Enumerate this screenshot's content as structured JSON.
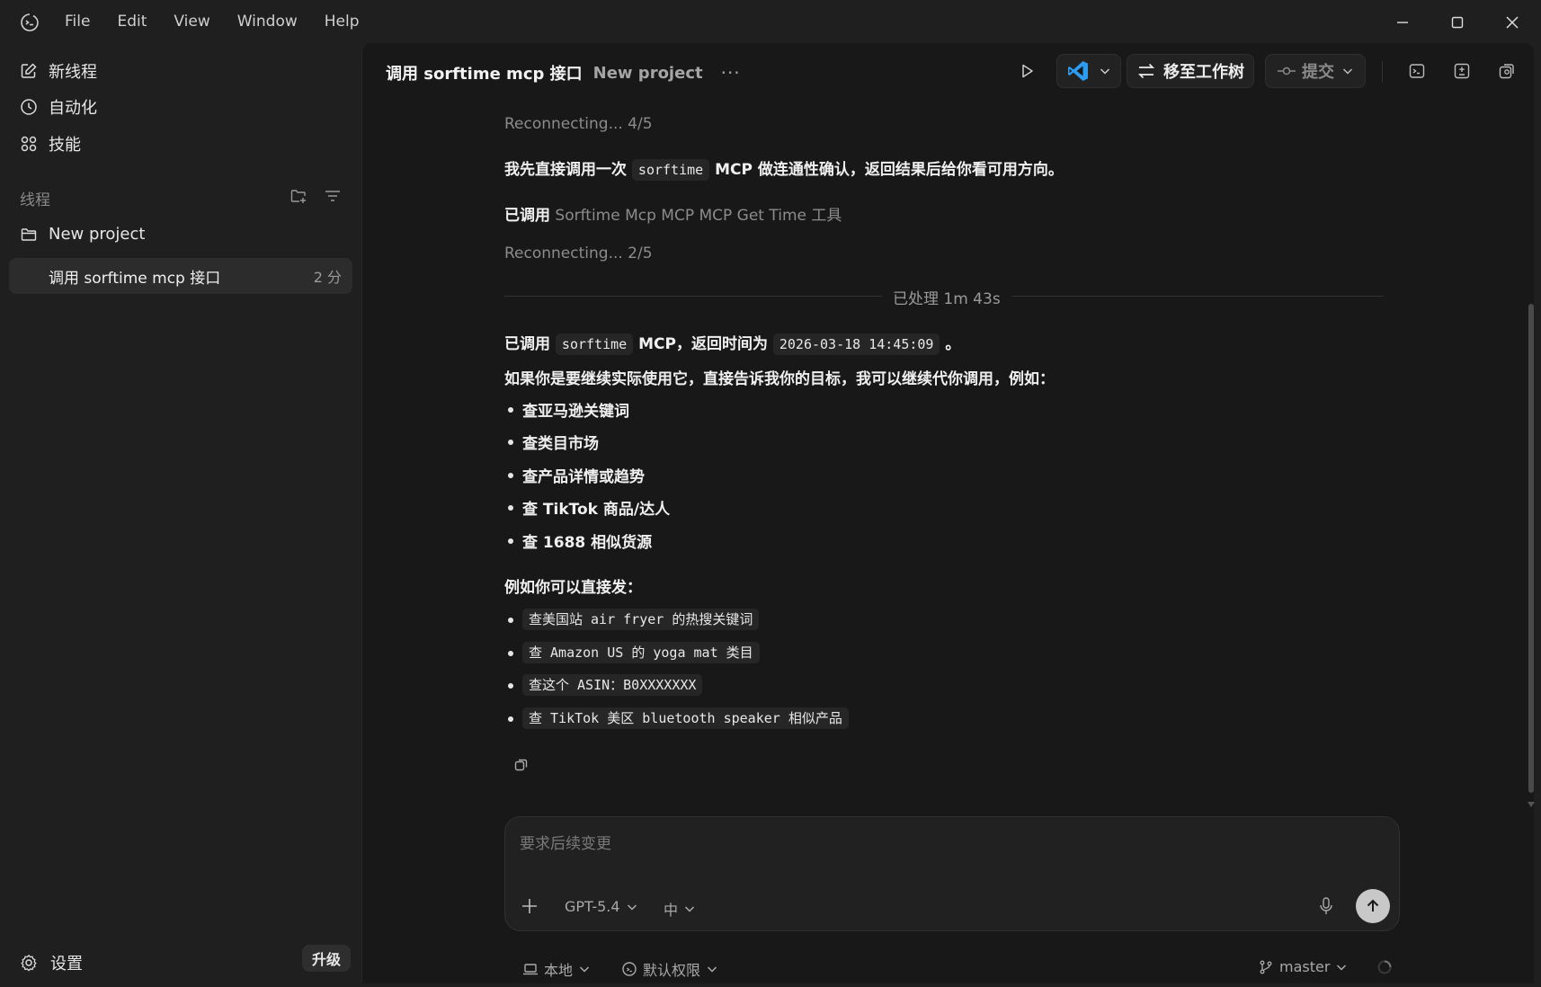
{
  "menu": [
    "File",
    "Edit",
    "Window",
    "Help"
  ],
  "menu_view": "View",
  "sidebar": {
    "new_thread": "新线程",
    "automation": "自动化",
    "skills": "技能",
    "section_label": "线程",
    "project": "New project",
    "thread": {
      "title": "调用 sorftime mcp 接口",
      "time": "2 分"
    },
    "settings": "设置",
    "upgrade": "升级"
  },
  "header": {
    "title": "调用 sorftime mcp 接口",
    "project": "New project",
    "more": "···",
    "move_to_worktree": "移至工作树",
    "commit": "提交"
  },
  "messages": {
    "reconnect1": "Reconnecting... 4/5",
    "intro_a": "我先直接调用一次",
    "intro_code": "sorftime",
    "intro_b": "MCP 做连通性确认，返回结果后给你看可用方向。",
    "tool_prefix": "已调用",
    "tool_name": "Sorftime Mcp MCP MCP Get Time 工具",
    "reconnect2": "Reconnecting... 2/5",
    "processed": "已处理 1m 43s",
    "result_a": "已调用",
    "result_code1": "sorftime",
    "result_b": "MCP，返回时间为",
    "result_code2": "2026-03-18 14:45:09",
    "result_c": "。",
    "followup": "如果你是要继续实际使用它，直接告诉我你的目标，我可以继续代你调用，例如：",
    "bullets": [
      "查亚马逊关键词",
      "查类目市场",
      "查产品详情或趋势",
      "查 TikTok 商品/达人",
      "查 1688 相似货源"
    ],
    "examples_label": "例如你可以直接发：",
    "examples": [
      "查美国站 air fryer 的热搜关键词",
      "查 Amazon US 的 yoga mat 类目",
      "查这个 ASIN：B0XXXXXXX",
      "查 TikTok 美区 bluetooth speaker 相似产品"
    ]
  },
  "composer": {
    "placeholder": "要求后续变更",
    "model": "GPT-5.4",
    "effort": "中"
  },
  "footer": {
    "env": "本地",
    "permission": "默认权限",
    "branch": "master"
  },
  "colors": {
    "accent_vscode": "#2d9cf0",
    "background": "#181818",
    "sidebar": "#1f1f1f"
  }
}
